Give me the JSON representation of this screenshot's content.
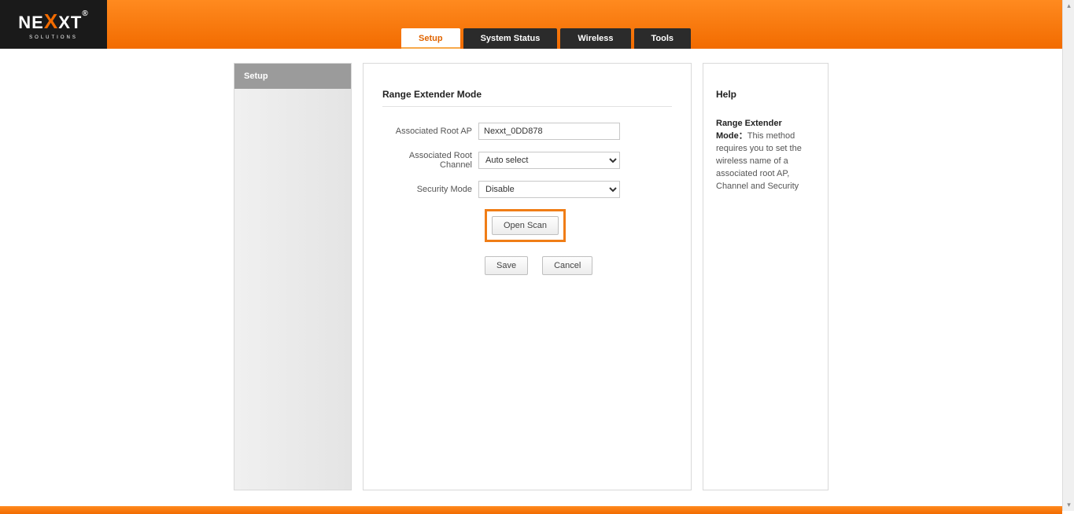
{
  "brand": {
    "name_before": "NE",
    "name_x": "X",
    "name_after": "XT",
    "sub": "SOLUTIONS"
  },
  "tabs": [
    {
      "label": "Setup",
      "active": true
    },
    {
      "label": "System Status",
      "active": false
    },
    {
      "label": "Wireless",
      "active": false
    },
    {
      "label": "Tools",
      "active": false
    }
  ],
  "sidebar": {
    "items": [
      {
        "label": "Setup"
      }
    ]
  },
  "panel": {
    "title": "Range Extender Mode",
    "root_ap": {
      "label": "Associated Root AP",
      "value": "Nexxt_0DD878"
    },
    "channel": {
      "label": "Associated Root Channel",
      "value": "Auto select",
      "options": [
        "Auto select"
      ]
    },
    "security": {
      "label": "Security Mode",
      "value": "Disable",
      "options": [
        "Disable"
      ]
    },
    "scan_label": "Open Scan",
    "save_label": "Save",
    "cancel_label": "Cancel"
  },
  "help": {
    "title": "Help",
    "term": "Range Extender Mode：",
    "body": "This method requires you to set the wireless name of a associated root AP, Channel and Security"
  }
}
